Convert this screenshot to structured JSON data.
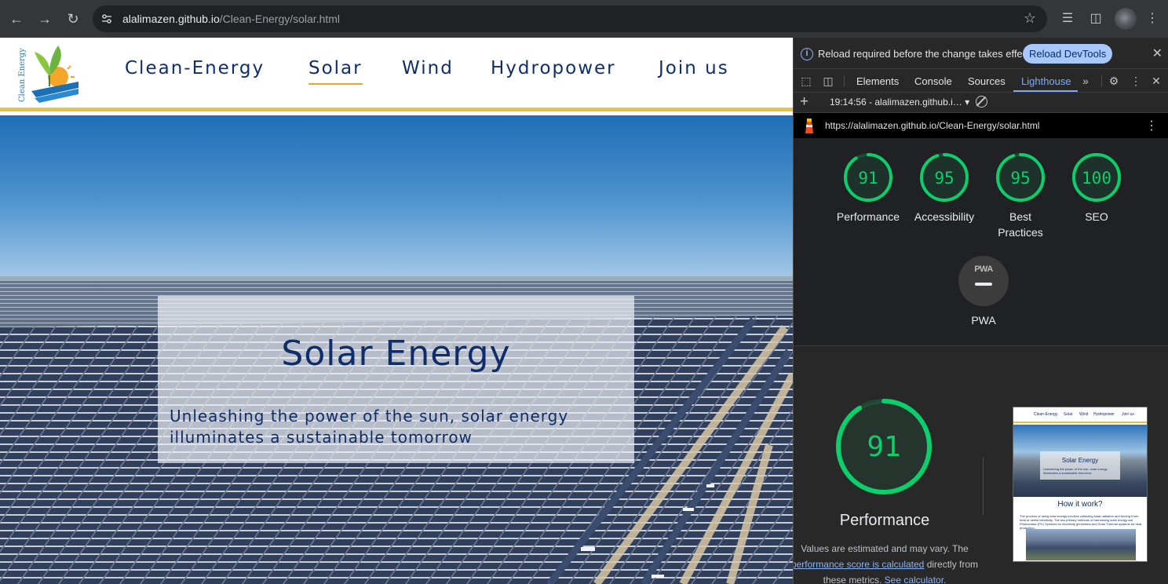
{
  "browser": {
    "url_host": "alalimazen.github.io",
    "url_path": "/Clean-Energy/solar.html"
  },
  "site": {
    "logo_text": "Clean Energy",
    "nav": [
      {
        "label": "Clean-Energy",
        "active": false
      },
      {
        "label": "Solar",
        "active": true
      },
      {
        "label": "Wind",
        "active": false
      },
      {
        "label": "Hydropower",
        "active": false
      },
      {
        "label": "Join us",
        "active": false
      }
    ],
    "hero": {
      "title": "Solar Energy",
      "subtitle": "Unleashing the power of the sun, solar energy illuminates a sustainable tomorrow"
    },
    "accent_color": "#e4c34a",
    "text_color": "#0f2d6b"
  },
  "devtools": {
    "info_text": "Reload required before the change takes effect.",
    "reload_button": "Reload DevTools",
    "tabs": [
      "Elements",
      "Console",
      "Sources",
      "Lighthouse"
    ],
    "active_tab": "Lighthouse",
    "report_selector": "19:14:56 - alalimazen.github.i…",
    "report_url": "https://alalimazen.github.io/Clean-Energy/solar.html",
    "scores": [
      {
        "label": "Performance",
        "score": 91
      },
      {
        "label": "Accessibility",
        "score": 95
      },
      {
        "label": "Best Practices",
        "score": 95
      },
      {
        "label": "SEO",
        "score": 100
      }
    ],
    "pwa": {
      "badge": "PWA",
      "label": "PWA"
    },
    "featured": {
      "label": "Performance",
      "score": 91,
      "note_prefix": "Values are estimated and may vary. The ",
      "note_link1": "performance score is calculated",
      "note_mid": " directly from these metrics. ",
      "note_link2": "See calculator."
    },
    "thumbnail": {
      "nav": [
        "Clean-Energy",
        "Solar",
        "Wind",
        "Hydropower",
        "Join us"
      ],
      "hero_title": "Solar Energy",
      "hero_sub": "Unleashing the power of the sun, solar energy illuminates a sustainable tomorrow",
      "section_title": "How it work?",
      "section_text": "The process of using solar energy involves collecting solar radiation and turning it into heat or useful electricity. The two primary methods of harnessing solar energy are Photovoltaic (PV) Systems for electricity generation and Solar Thermal systems for heat production."
    },
    "score_color": "#0cce6b"
  }
}
